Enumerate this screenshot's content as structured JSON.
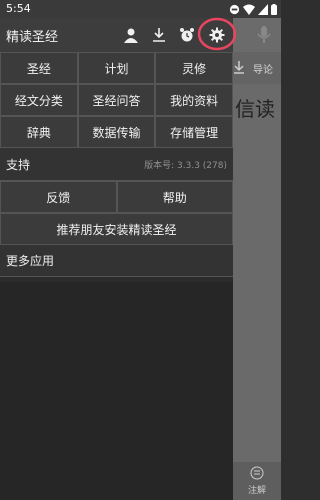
{
  "status": {
    "time": "5:54"
  },
  "app_bg": {
    "tab_label": "导论",
    "text": "信读",
    "bottom_label": "注解"
  },
  "drawer": {
    "title": "精读圣经",
    "menu_row1": [
      "圣经",
      "计划",
      "灵修"
    ],
    "menu_row2": [
      "经文分类",
      "圣经问答",
      "我的资料"
    ],
    "menu_row3": [
      "辞典",
      "数据传输",
      "存储管理"
    ],
    "support_label": "支持",
    "version": "版本号: 3.3.3 (278)",
    "feedback_label": "反馈",
    "help_label": "帮助",
    "recommend_label": "推荐朋友安装精读圣经",
    "more_apps_label": "更多应用"
  }
}
